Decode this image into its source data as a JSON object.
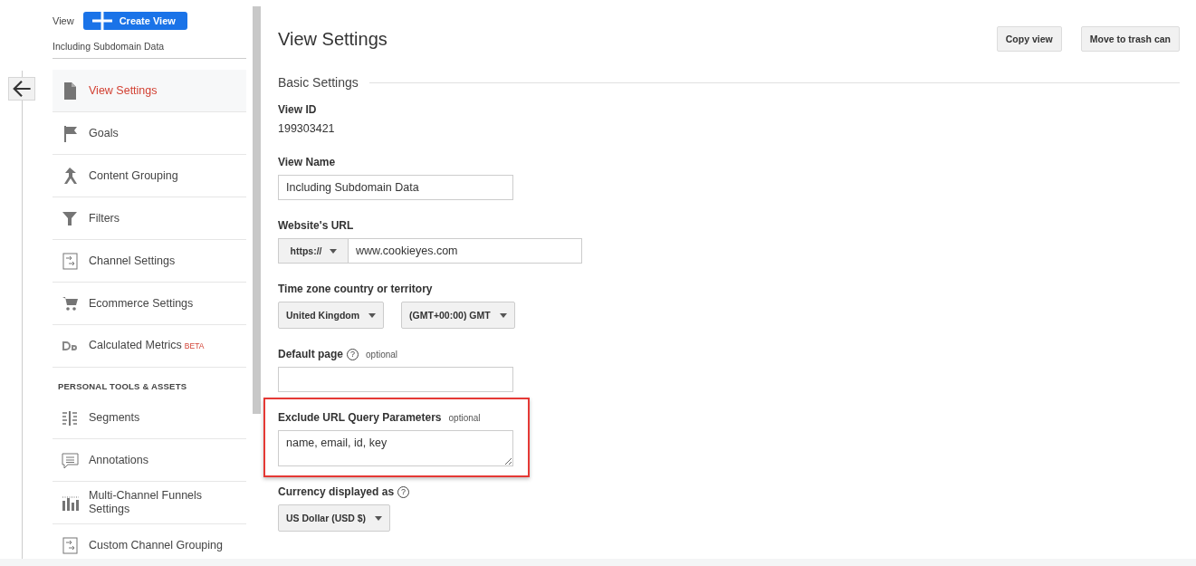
{
  "sidebar": {
    "view_label": "View",
    "create_button": "Create View",
    "view_name": "Including Subdomain Data",
    "items": [
      {
        "kind": "item",
        "label": "View Settings",
        "selected": true
      },
      {
        "kind": "item",
        "label": "Goals",
        "selected": false
      },
      {
        "kind": "item",
        "label": "Content Grouping",
        "selected": false
      },
      {
        "kind": "item",
        "label": "Filters",
        "selected": false
      },
      {
        "kind": "item",
        "label": "Channel Settings",
        "selected": false
      },
      {
        "kind": "item",
        "label": "Ecommerce Settings",
        "selected": false
      },
      {
        "kind": "item",
        "label": "Calculated Metrics",
        "badge": "BETA",
        "selected": false
      },
      {
        "kind": "header",
        "label": "PERSONAL TOOLS & ASSETS"
      },
      {
        "kind": "item",
        "label": "Segments",
        "selected": false
      },
      {
        "kind": "item",
        "label": "Annotations",
        "selected": false
      },
      {
        "kind": "item",
        "label": "Multi-Channel Funnels Settings",
        "selected": false
      },
      {
        "kind": "item",
        "label": "Custom Channel Grouping",
        "selected": false
      }
    ]
  },
  "main": {
    "title": "View Settings",
    "buttons": [
      "Copy view",
      "Move to trash can"
    ],
    "section": "Basic Settings",
    "fields": [
      {
        "kind": "static",
        "label": "View ID",
        "value": "199303421"
      },
      {
        "kind": "input",
        "label": "View Name",
        "value": "Including Subdomain Data"
      },
      {
        "kind": "url",
        "label": "Website's URL",
        "protocol": "https://",
        "value": "www.cookieyes.com"
      },
      {
        "kind": "selects",
        "label": "Time zone country or territory",
        "options": [
          "United Kingdom",
          "(GMT+00:00) GMT"
        ]
      },
      {
        "kind": "input",
        "label": "Default page",
        "help": "?",
        "note": "optional"
      },
      {
        "kind": "textarea",
        "label": "Exclude URL Query Parameters",
        "note": "optional",
        "value": "name, email, id, key",
        "highlighted": true
      },
      {
        "kind": "selects",
        "label": "Currency displayed as",
        "help": "?",
        "options": [
          "US Dollar (USD $)"
        ]
      }
    ]
  }
}
